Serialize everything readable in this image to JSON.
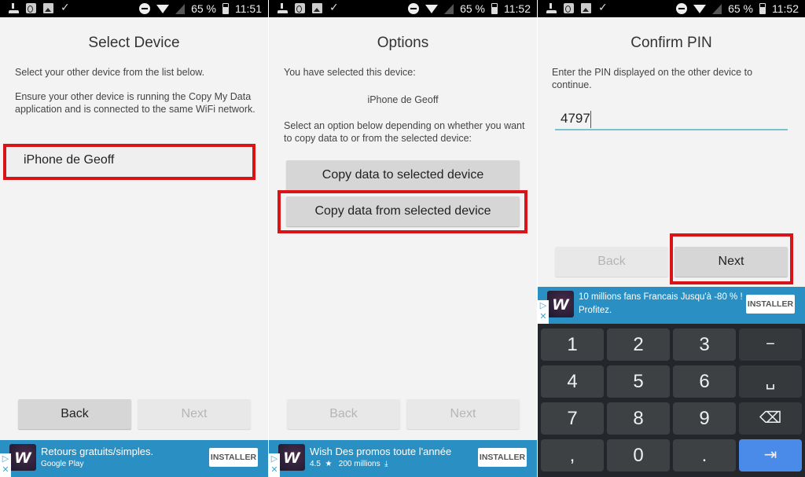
{
  "panels": [
    {
      "status": {
        "battery": "65 %",
        "time": "11:51"
      },
      "title": "Select Device",
      "paragraphs": [
        "Select your other device from the list below.",
        "Ensure your other device is running the Copy My Data application and is connected to the same WiFi network."
      ],
      "device_list": [
        "iPhone de Geoff"
      ],
      "buttons": {
        "back": "Back",
        "next": "Next"
      },
      "ad": {
        "title": "Retours gratuits/simples.",
        "subtitle": "Google Play",
        "install": "INSTALLER"
      }
    },
    {
      "status": {
        "battery": "65 %",
        "time": "11:52"
      },
      "title": "Options",
      "paragraphs": [
        "You have selected this device:",
        "iPhone de Geoff",
        "Select an option below depending on whether you want to copy data to or from the selected device:"
      ],
      "options": [
        "Copy data to selected device",
        "Copy data from selected device"
      ],
      "buttons": {
        "back": "Back",
        "next": "Next"
      },
      "ad": {
        "title": "Wish Des promos toute l'année",
        "rating": "4.5",
        "downloads": "200 millions",
        "install": "INSTALLER"
      }
    },
    {
      "status": {
        "battery": "65 %",
        "time": "11:52"
      },
      "title": "Confirm PIN",
      "paragraphs": [
        "Enter the PIN displayed on the other device to continue."
      ],
      "pin_value": "4797",
      "buttons": {
        "back": "Back",
        "next": "Next"
      },
      "ad": {
        "title": "10 millions fans Francais Jusqu'à -80 % !",
        "subtitle": "Profitez.",
        "install": "INSTALLER"
      },
      "keyboard": {
        "keys": [
          "1",
          "2",
          "3",
          "−",
          "4",
          "5",
          "6",
          "␣",
          "7",
          "8",
          "9",
          "⌫",
          ",",
          "0",
          ".",
          "⇥"
        ]
      }
    }
  ],
  "ad_logo": "w",
  "ad_choices": {
    "play": "▷",
    "close": "✕"
  },
  "colors": {
    "highlight": "#d81418",
    "ad_bg": "#2a90c3",
    "enter_key": "#4a8ae8",
    "pin_underline": "#7cc1d2"
  }
}
